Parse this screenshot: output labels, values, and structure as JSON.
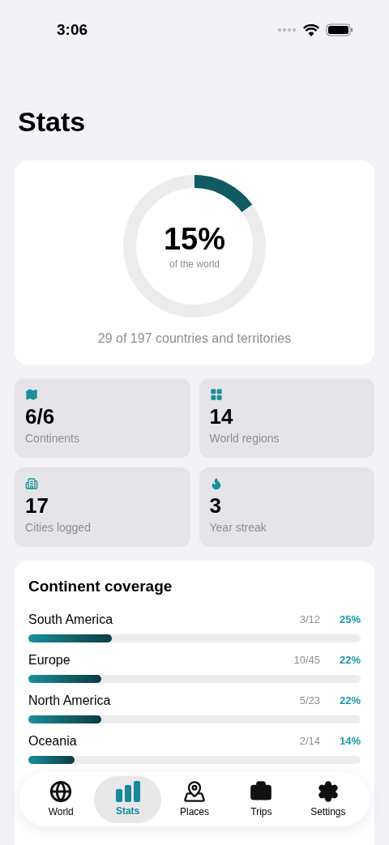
{
  "status_bar": {
    "time": "3:06"
  },
  "title": "Stats",
  "progress": {
    "percent": "15%",
    "caption": "of the world",
    "level": 0.15,
    "summary": "29 of 197 countries and territories"
  },
  "stats": [
    {
      "kind": "map",
      "value": "6/6",
      "label": "Continents"
    },
    {
      "kind": "grid",
      "value": "14",
      "label": "World regions"
    },
    {
      "kind": "building",
      "value": "17",
      "label": "Cities logged"
    },
    {
      "kind": "flame",
      "value": "3",
      "label": "Year streak"
    }
  ],
  "coverage": {
    "title": "Continent coverage",
    "rows": [
      {
        "name": "South America",
        "count": "3/12",
        "percent": "25%",
        "level": 0.25
      },
      {
        "name": "Europe",
        "count": "10/45",
        "percent": "22%",
        "level": 0.22
      },
      {
        "name": "North America",
        "count": "5/23",
        "percent": "22%",
        "level": 0.22
      },
      {
        "name": "Oceania",
        "count": "2/14",
        "percent": "14%",
        "level": 0.14
      }
    ]
  },
  "tabs": [
    {
      "kind": "globe",
      "label": "World",
      "selected": false
    },
    {
      "kind": "chart",
      "label": "Stats",
      "selected": true
    },
    {
      "kind": "pin",
      "label": "Places",
      "selected": false
    },
    {
      "kind": "suitcase",
      "label": "Trips",
      "selected": false
    },
    {
      "kind": "gear",
      "label": "Settings",
      "selected": false
    }
  ]
}
